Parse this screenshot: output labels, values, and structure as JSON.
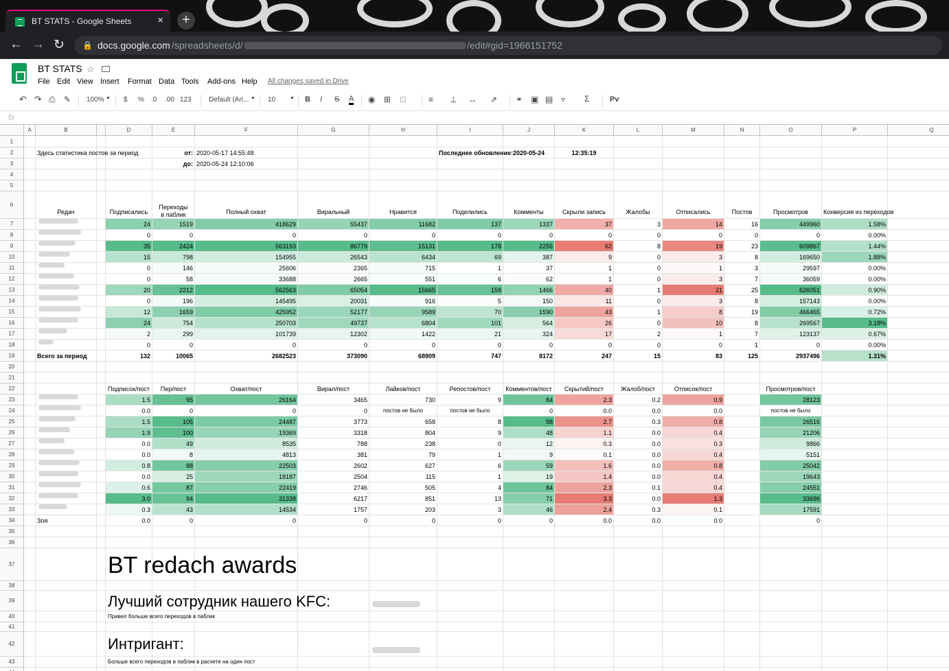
{
  "browser": {
    "tab_title": "BT STATS - Google Sheets",
    "tab_close": "×",
    "new_tab": "+",
    "url_host": "docs.google.com",
    "url_path": "/spreadsheets/d/",
    "url_tail": "/edit#gid=1966151752"
  },
  "app": {
    "title": "BT STATS",
    "menus": [
      "File",
      "Edit",
      "View",
      "Insert",
      "Format",
      "Data",
      "Tools",
      "Add-ons",
      "Help"
    ],
    "saved_status": "All changes saved in Drive"
  },
  "toolbar": {
    "zoom": "100%",
    "currency": "$",
    "percent": "%",
    "dec_less": ".0",
    "dec_more": ".00",
    "more_formats": "123",
    "font": "Default (Ari...",
    "font_size": "10",
    "bold": "B",
    "italic": "I",
    "strike": "S",
    "text_color": "A",
    "sum": "Σ",
    "input_tool": "Pv"
  },
  "fx": "fx",
  "columns": [
    "A",
    "B",
    "",
    "D",
    "E",
    "F",
    "G",
    "H",
    "I",
    "J",
    "K",
    "L",
    "M",
    "N",
    "O",
    "P",
    "Q"
  ],
  "cells": [
    {
      "r": 2,
      "c": "B",
      "t": "Здесь статистика постов за период",
      "a": "l"
    },
    {
      "r": 2,
      "c": "E",
      "t": "от:",
      "a": "r",
      "b": true
    },
    {
      "r": 2,
      "c": "F",
      "t": "2020-05-17 14:55:48",
      "a": "l"
    },
    {
      "r": 2,
      "c": "I",
      "t": "Последнее обновление:",
      "a": "r",
      "b": true
    },
    {
      "r": 2,
      "c": "J",
      "t": "2020-05-24",
      "a": "c",
      "b": true
    },
    {
      "r": 2,
      "c": "K",
      "t": "12:35:19",
      "a": "c",
      "b": true
    },
    {
      "r": 3,
      "c": "E",
      "t": "до:",
      "a": "r",
      "b": true
    },
    {
      "r": 3,
      "c": "F",
      "t": "2020-05-24 12:10:06",
      "a": "l"
    }
  ],
  "headers1": [
    "Редач",
    "Подписались",
    "Переходы\nв паблик",
    "Полный охват",
    "Виральный",
    "Нравится",
    "Поделились",
    "Комменты",
    "Скрыли запись",
    "Жалобы",
    "Отписались",
    "Постов",
    "Просмотров",
    "Конверсия из переходов"
  ],
  "table1": [
    [
      24,
      1519,
      418629,
      55437,
      11682,
      137,
      1337,
      37,
      3,
      14,
      16,
      449960,
      "1.58%"
    ],
    [
      0,
      0,
      0,
      0,
      0,
      0,
      0,
      0,
      0,
      0,
      0,
      0,
      "0.00%"
    ],
    [
      35,
      2424,
      563193,
      86779,
      15131,
      178,
      2255,
      62,
      8,
      19,
      23,
      609867,
      "1.44%"
    ],
    [
      15,
      798,
      154955,
      26543,
      6434,
      69,
      387,
      9,
      0,
      3,
      8,
      169650,
      "1.88%"
    ],
    [
      0,
      146,
      25606,
      2365,
      715,
      1,
      37,
      1,
      0,
      1,
      3,
      29597,
      "0.00%"
    ],
    [
      0,
      58,
      33688,
      2665,
      551,
      6,
      62,
      1,
      0,
      3,
      7,
      36059,
      "0.00%"
    ],
    [
      20,
      2212,
      562563,
      65054,
      15665,
      159,
      1466,
      40,
      1,
      21,
      25,
      626051,
      "0.90%"
    ],
    [
      0,
      196,
      145495,
      20031,
      916,
      5,
      150,
      11,
      0,
      3,
      8,
      157143,
      "0.00%"
    ],
    [
      12,
      1659,
      425952,
      52177,
      9589,
      70,
      1590,
      43,
      1,
      8,
      19,
      466465,
      "0.72%"
    ],
    [
      24,
      754,
      250703,
      49737,
      6804,
      101,
      564,
      26,
      0,
      10,
      8,
      269567,
      "3.18%"
    ],
    [
      2,
      299,
      101739,
      12302,
      1422,
      21,
      324,
      17,
      2,
      1,
      7,
      123137,
      "0.67%"
    ],
    [
      0,
      0,
      0,
      0,
      0,
      0,
      0,
      0,
      0,
      0,
      1,
      0,
      "0.00%"
    ]
  ],
  "total_label": "Всего за период",
  "totals": [
    132,
    10065,
    2682523,
    373090,
    68909,
    747,
    8172,
    247,
    15,
    83,
    125,
    2937496,
    "1.31%"
  ],
  "headers2": [
    "Подписок/пост",
    "Пер/пост",
    "Охват/пост",
    "Вирал/пост",
    "Лайков/пост",
    "Репостов/пост",
    "Комментов/пост",
    "Скрытий/пост",
    "Жалоб/пост",
    "Отписок/пост",
    "Просмотров/пост"
  ],
  "table2": [
    [
      "1.5",
      "95",
      "26164",
      "3465",
      "730",
      "9",
      "84",
      "2.3",
      "0.2",
      "0.9",
      "28123"
    ],
    [
      "0.0",
      "0",
      "0",
      "0",
      "постов не было",
      "постов не было",
      "0",
      "0.0",
      "0.0",
      "0.0",
      "постов не было"
    ],
    [
      "1.5",
      "105",
      "24487",
      "3773",
      "658",
      "8",
      "98",
      "2.7",
      "0.3",
      "0.8",
      "26516"
    ],
    [
      "1.9",
      "100",
      "19369",
      "3318",
      "804",
      "9",
      "48",
      "1.1",
      "0.0",
      "0.4",
      "21206"
    ],
    [
      "0.0",
      "49",
      "8535",
      "788",
      "238",
      "0",
      "12",
      "0.3",
      "0.0",
      "0.3",
      "9866"
    ],
    [
      "0.0",
      "8",
      "4813",
      "381",
      "79",
      "1",
      "9",
      "0.1",
      "0.0",
      "0.4",
      "5151"
    ],
    [
      "0.8",
      "88",
      "22503",
      "2602",
      "627",
      "6",
      "59",
      "1.6",
      "0.0",
      "0.8",
      "25042"
    ],
    [
      "0.0",
      "25",
      "18187",
      "2504",
      "115",
      "1",
      "19",
      "1.4",
      "0.0",
      "0.4",
      "19643"
    ],
    [
      "0.6",
      "87",
      "22419",
      "2746",
      "505",
      "4",
      "84",
      "2.3",
      "0.1",
      "0.4",
      "24551"
    ],
    [
      "3.0",
      "94",
      "31338",
      "6217",
      "851",
      "13",
      "71",
      "3.3",
      "0.0",
      "1.3",
      "33696"
    ],
    [
      "0.3",
      "43",
      "14534",
      "1757",
      "203",
      "3",
      "46",
      "2.4",
      "0.3",
      "0.1",
      "17591"
    ],
    [
      "0.0",
      "0",
      "0",
      "0",
      "0",
      "0",
      "0",
      "0.0",
      "0.0",
      "0.0",
      "0"
    ]
  ],
  "row34_name": "Зоя",
  "awards": {
    "title": "BT redach awards",
    "best_label": "Лучший сотрудник нашего KFC:",
    "best_desc": "Привел больше всего переходов в паблик",
    "intrigan_label": "Интригант:",
    "intrigan_desc": "Больше всего переходов в паблик в расчете на один пост"
  },
  "colors": {
    "green": "#57bb8a",
    "red": "#e67c73",
    "header_bg": "#f8f9fa",
    "sheets_green": "#0f9d58"
  }
}
